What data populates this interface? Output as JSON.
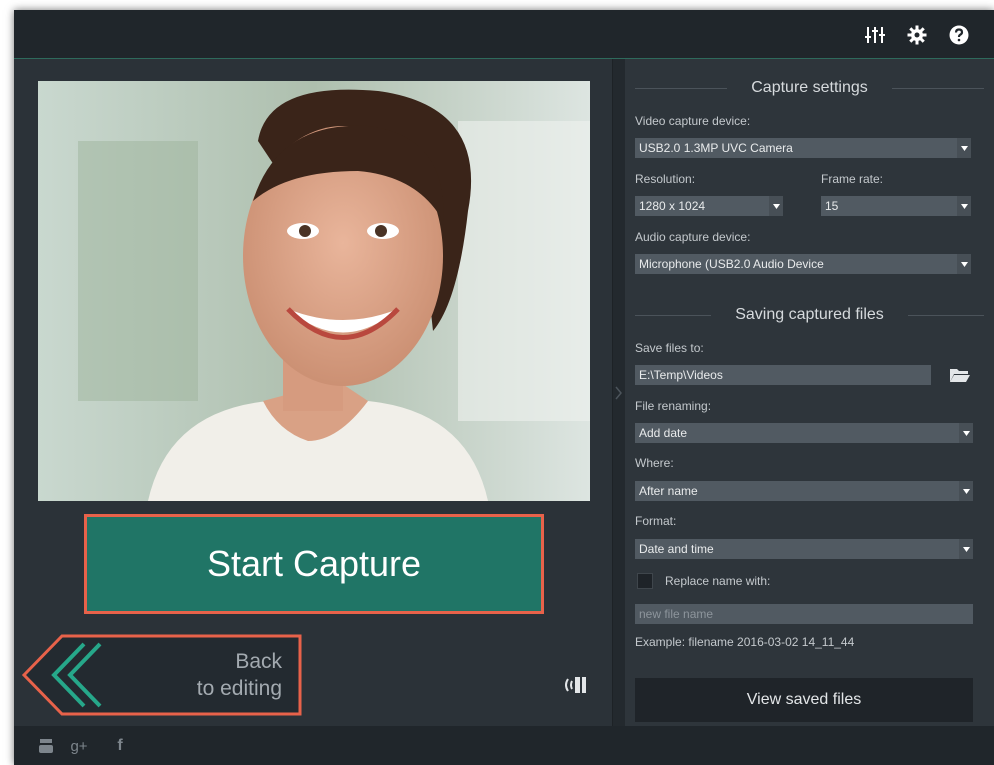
{
  "colors": {
    "accent": "#207566",
    "highlight_border": "#e8624a",
    "window_bg": "#272e35"
  },
  "toolbar": {
    "icons": [
      "equalizer-icon",
      "gear-icon",
      "help-icon"
    ]
  },
  "preview": {
    "content": "webcam-preview-image"
  },
  "start_capture": {
    "label": "Start Capture"
  },
  "back": {
    "line1": "Back",
    "line2": "to editing"
  },
  "capture_settings": {
    "title": "Capture settings",
    "video_device_label": "Video capture device:",
    "video_device_value": "USB2.0 1.3MP UVC Camera",
    "resolution_label": "Resolution:",
    "resolution_value": "1280 x 1024",
    "frame_rate_label": "Frame rate:",
    "frame_rate_value": "15",
    "audio_device_label": "Audio capture device:",
    "audio_device_value": "Microphone (USB2.0 Audio Device"
  },
  "saving": {
    "title": "Saving captured files",
    "save_to_label": "Save files to:",
    "save_to_value": "E:\\Temp\\Videos",
    "renaming_label": "File renaming:",
    "renaming_value": "Add date",
    "where_label": "Where:",
    "where_value": "After name",
    "format_label": "Format:",
    "format_value": "Date and time",
    "replace_label": "Replace name with:",
    "replace_checked": false,
    "new_name_placeholder": "new file name",
    "example": "Example: filename 2016-03-02 14_11_44"
  },
  "view_saved": {
    "label": "View saved files"
  },
  "footer": {
    "social": [
      "youtube-icon",
      "google-plus-icon",
      "facebook-icon"
    ],
    "gplus_text": "g+",
    "fb_text": "f"
  }
}
